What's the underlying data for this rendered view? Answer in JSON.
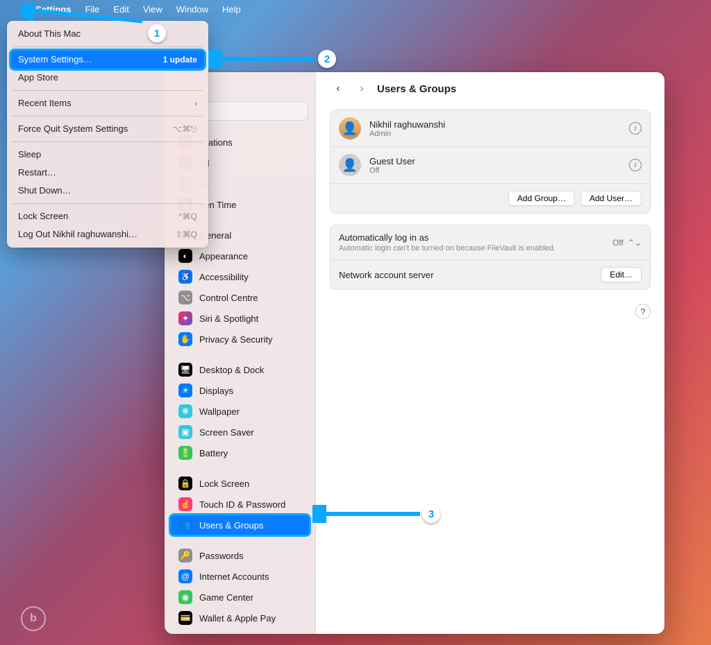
{
  "menubar": {
    "app": "m Settings",
    "items": [
      "File",
      "Edit",
      "View",
      "Window",
      "Help"
    ]
  },
  "apple_menu": {
    "about": "About This Mac",
    "system_settings": "System Settings…",
    "system_settings_badge": "1 update",
    "app_store": "App Store",
    "recent_items": "Recent Items",
    "force_quit": "Force Quit System Settings",
    "force_quit_kbd": "⌥⌘⎋",
    "sleep": "Sleep",
    "restart": "Restart…",
    "shutdown": "Shut Down…",
    "lock_screen": "Lock Screen",
    "lock_kbd": "^⌘Q",
    "log_out": "Log Out Nikhil raghuwanshi…",
    "log_out_kbd": "⇧⌘Q"
  },
  "sidebar": {
    "search_placeholder": "Search",
    "partial": [
      {
        "icon": "🔔",
        "bg": "#ff3b30",
        "label": "fications"
      },
      {
        "icon": "🔊",
        "bg": "#ff3b77",
        "label": "nd"
      },
      {
        "icon": "🌙",
        "bg": "#8c64d8",
        "label": "us"
      },
      {
        "icon": "⏳",
        "bg": "#5856d6",
        "label": "een Time"
      }
    ],
    "group2": [
      {
        "icon": "⚙",
        "bg": "#8e8e93",
        "label": "General"
      },
      {
        "icon": "◐",
        "bg": "#000000",
        "label": "Appearance"
      },
      {
        "icon": "♿",
        "bg": "#007aff",
        "label": "Accessibility"
      },
      {
        "icon": "⌥",
        "bg": "#8e8e93",
        "label": "Control Centre"
      },
      {
        "icon": "✦",
        "bg": "linear-gradient(135deg,#ff2d55,#5856d6)",
        "label": "Siri & Spotlight"
      },
      {
        "icon": "✋",
        "bg": "#007aff",
        "label": "Privacy & Security"
      }
    ],
    "group3": [
      {
        "icon": "🖥",
        "bg": "#000000",
        "label": "Desktop & Dock"
      },
      {
        "icon": "☀",
        "bg": "#007aff",
        "label": "Displays"
      },
      {
        "icon": "❋",
        "bg": "#34c8e0",
        "label": "Wallpaper"
      },
      {
        "icon": "▣",
        "bg": "#34c8e0",
        "label": "Screen Saver"
      },
      {
        "icon": "🔋",
        "bg": "#34c759",
        "label": "Battery"
      }
    ],
    "group4": [
      {
        "icon": "🔒",
        "bg": "#000000",
        "label": "Lock Screen"
      },
      {
        "icon": "☝",
        "bg": "#ff3b77",
        "label": "Touch ID & Password"
      },
      {
        "icon": "👥",
        "bg": "#007aff",
        "label": "Users & Groups",
        "selected": true
      }
    ],
    "group5": [
      {
        "icon": "🔑",
        "bg": "#8e8e93",
        "label": "Passwords"
      },
      {
        "icon": "@",
        "bg": "#007aff",
        "label": "Internet Accounts"
      },
      {
        "icon": "◉",
        "bg": "#34c759",
        "label": "Game Center"
      },
      {
        "icon": "💳",
        "bg": "#000000",
        "label": "Wallet & Apple Pay"
      }
    ]
  },
  "content": {
    "title": "Users & Groups",
    "users": [
      {
        "name": "Nikhil raghuwanshi",
        "sub": "Admin",
        "avatar": "photo"
      },
      {
        "name": "Guest User",
        "sub": "Off",
        "avatar": "guest"
      }
    ],
    "add_group": "Add Group…",
    "add_user": "Add User…",
    "auto_login_label": "Automatically log in as",
    "auto_login_value": "Off",
    "auto_login_subtitle": "Automatic login can't be turned on because FileVault is enabled.",
    "network_server_label": "Network account server",
    "edit": "Edit…"
  },
  "annotations": {
    "n1": "1",
    "n2": "2",
    "n3": "3"
  }
}
